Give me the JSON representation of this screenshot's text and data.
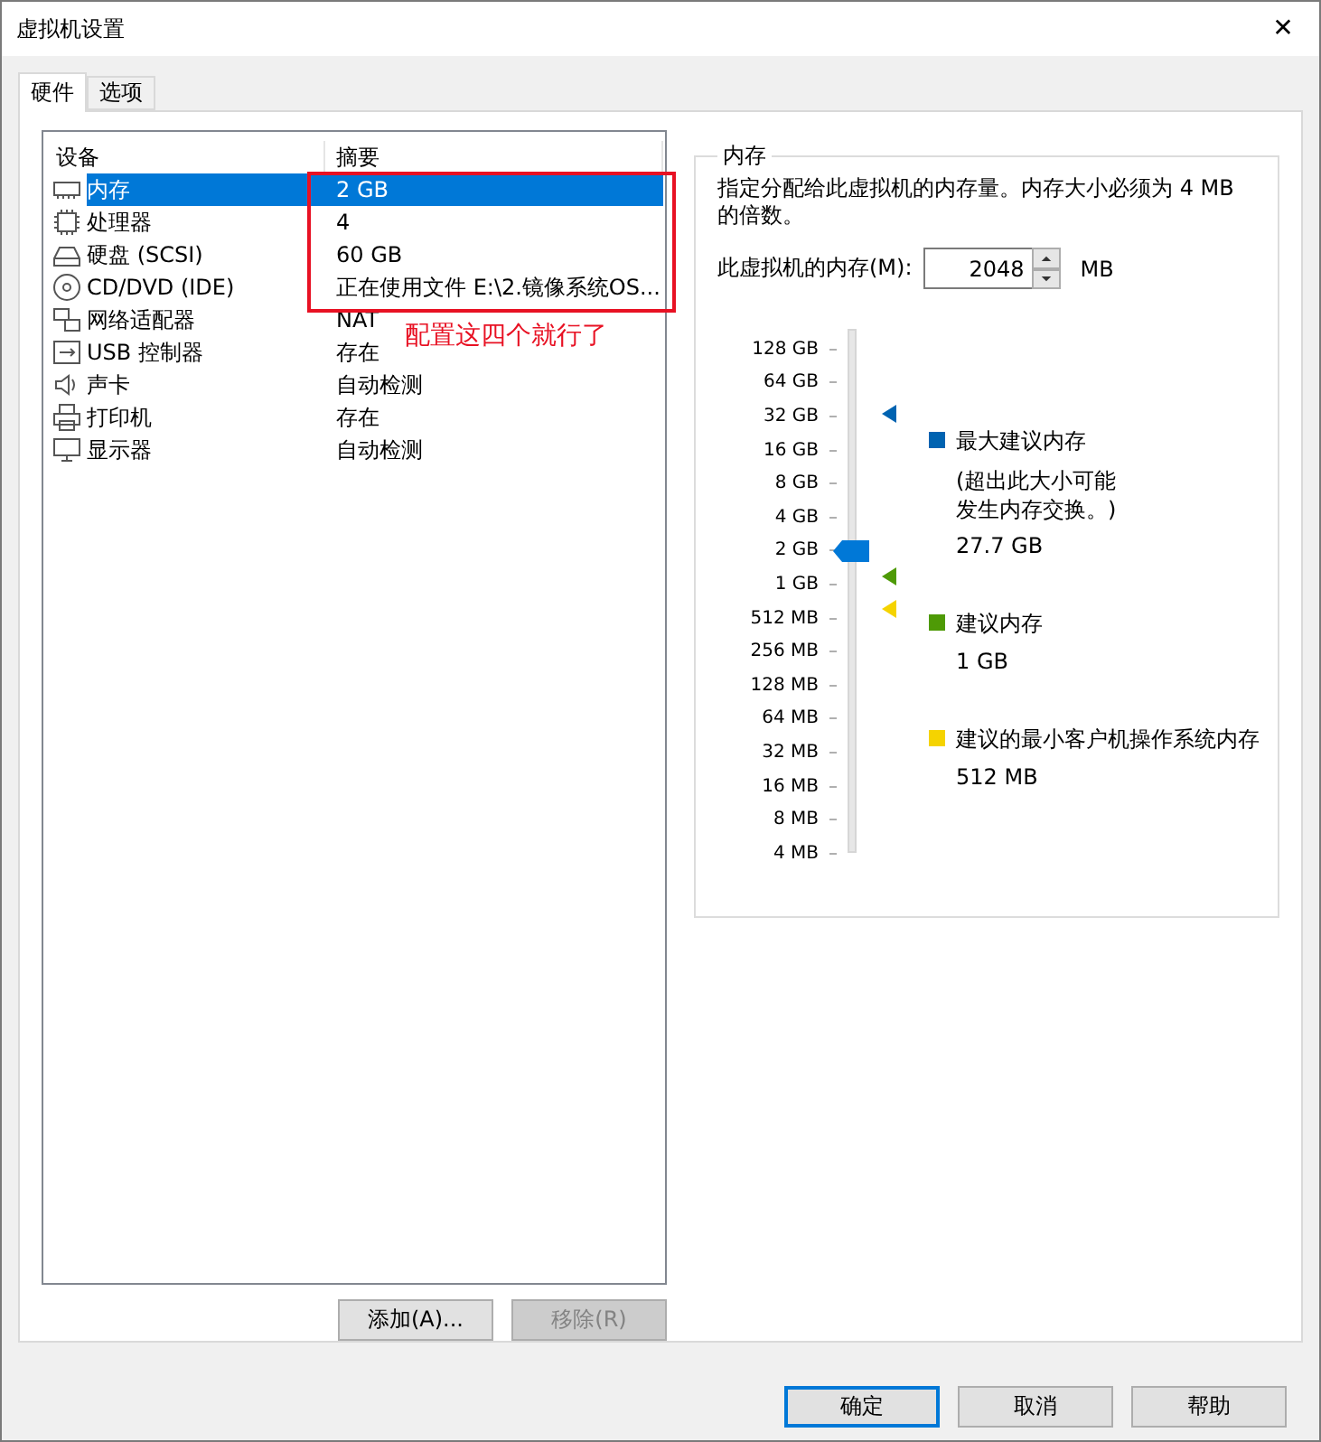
{
  "window": {
    "title": "虚拟机设置",
    "close": "✕"
  },
  "tabs": [
    {
      "label": "硬件",
      "selected": true
    },
    {
      "label": "选项",
      "selected": false
    }
  ],
  "devices": {
    "columns": [
      "设备",
      "摘要"
    ],
    "rows": [
      {
        "kind": "memory",
        "name": "内存",
        "summary": "2 GB",
        "selected": true
      },
      {
        "kind": "cpu",
        "name": "处理器",
        "summary": "4",
        "selected": false
      },
      {
        "kind": "disk",
        "name": "硬盘 (SCSI)",
        "summary": "60 GB",
        "selected": false
      },
      {
        "kind": "cd",
        "name": "CD/DVD (IDE)",
        "summary": "正在使用文件 E:\\2.镜像系统OS...",
        "selected": false
      },
      {
        "kind": "network",
        "name": "网络适配器",
        "summary": "NAT",
        "selected": false
      },
      {
        "kind": "usb",
        "name": "USB 控制器",
        "summary": "存在",
        "selected": false
      },
      {
        "kind": "sound",
        "name": "声卡",
        "summary": "自动检测",
        "selected": false
      },
      {
        "kind": "printer",
        "name": "打印机",
        "summary": "存在",
        "selected": false
      },
      {
        "kind": "display",
        "name": "显示器",
        "summary": "自动检测",
        "selected": false
      }
    ],
    "buttons": [
      {
        "label": "添加(A)...",
        "disabled": false
      },
      {
        "label": "移除(R)",
        "disabled": true
      }
    ]
  },
  "annotation": {
    "text": "配置这四个就行了"
  },
  "memory": {
    "title": "内存",
    "description": "指定分配给此虚拟机的内存量。内存大小必须为 4 MB 的倍数。",
    "field_label": "此虚拟机的内存(M):",
    "value": "2048",
    "unit": "MB",
    "slider": {
      "ticks": [
        "128 GB",
        "64 GB",
        "32 GB",
        "16 GB",
        "8 GB",
        "4 GB",
        "2 GB",
        "1 GB",
        "512 MB",
        "256 MB",
        "128 MB",
        "64 MB",
        "32 MB",
        "16 MB",
        "8 MB",
        "4 MB"
      ],
      "level": 0.6
    },
    "legend": [
      {
        "color": "#0063b1",
        "label": "最大建议内存",
        "note": "(超出此大小可能发生内存交换。)",
        "value": "27.7 GB"
      },
      {
        "color": "#4e9a06",
        "label": "建议内存",
        "value": "1 GB"
      },
      {
        "color": "#f5d300",
        "label": "建议的最小客户机操作系统内存",
        "value": "512 MB"
      }
    ]
  },
  "footer": [
    {
      "label": "确定",
      "default": true
    },
    {
      "label": "取消",
      "default": false
    },
    {
      "label": "帮助",
      "default": false
    }
  ]
}
